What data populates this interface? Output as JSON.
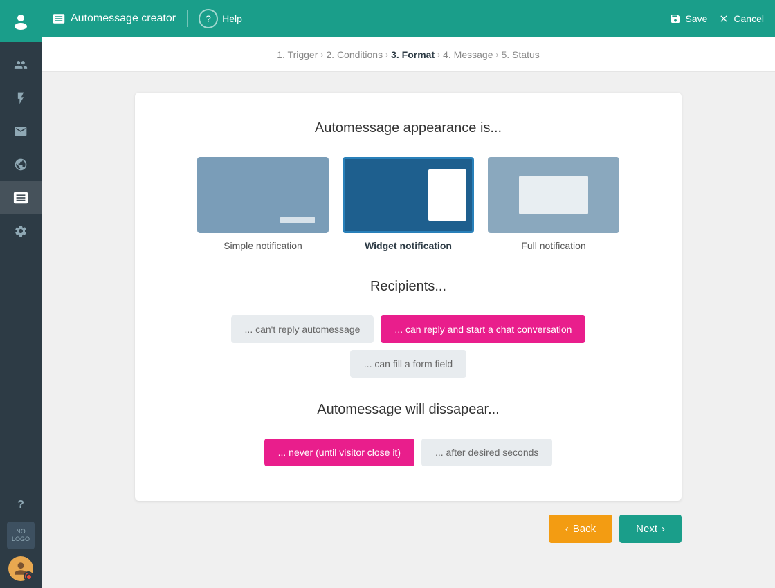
{
  "app": {
    "title": "Automessage creator",
    "help_label": "Help",
    "save_label": "Save",
    "cancel_label": "Cancel"
  },
  "breadcrumb": {
    "steps": [
      {
        "id": "trigger",
        "label": "1. Trigger",
        "active": false
      },
      {
        "id": "conditions",
        "label": "2. Conditions",
        "active": false
      },
      {
        "id": "format",
        "label": "3. Format",
        "active": true
      },
      {
        "id": "message",
        "label": "4. Message",
        "active": false
      },
      {
        "id": "status",
        "label": "5. Status",
        "active": false
      }
    ]
  },
  "main": {
    "appearance_title": "Automessage appearance is...",
    "notification_options": [
      {
        "id": "simple",
        "label": "Simple notification",
        "selected": false
      },
      {
        "id": "widget",
        "label": "Widget notification",
        "selected": true
      },
      {
        "id": "full",
        "label": "Full notification",
        "selected": false
      }
    ],
    "recipients_title": "Recipients...",
    "recipient_buttons": [
      {
        "id": "cant-reply",
        "label": "... can't reply automessage",
        "active": false
      },
      {
        "id": "can-reply",
        "label": "... can reply and start a chat conversation",
        "active": true
      },
      {
        "id": "fill-form",
        "label": "... can fill a form field",
        "active": false
      }
    ],
    "disappear_title": "Automessage will dissapear...",
    "disappear_buttons": [
      {
        "id": "never",
        "label": "... never (until visitor close it)",
        "active": true
      },
      {
        "id": "after-seconds",
        "label": "... after desired seconds",
        "active": false
      }
    ]
  },
  "footer": {
    "back_label": "Back",
    "next_label": "Next"
  },
  "sidebar": {
    "items": [
      {
        "id": "users",
        "icon": "👥"
      },
      {
        "id": "lightning",
        "icon": "⚡"
      },
      {
        "id": "inbox",
        "icon": "✉"
      },
      {
        "id": "globe",
        "icon": "🌐"
      },
      {
        "id": "user-active",
        "icon": "⬛",
        "active": true
      },
      {
        "id": "settings",
        "icon": "⚙"
      }
    ],
    "no_logo_text": "NO\nLOGO",
    "help_icon": "?"
  }
}
